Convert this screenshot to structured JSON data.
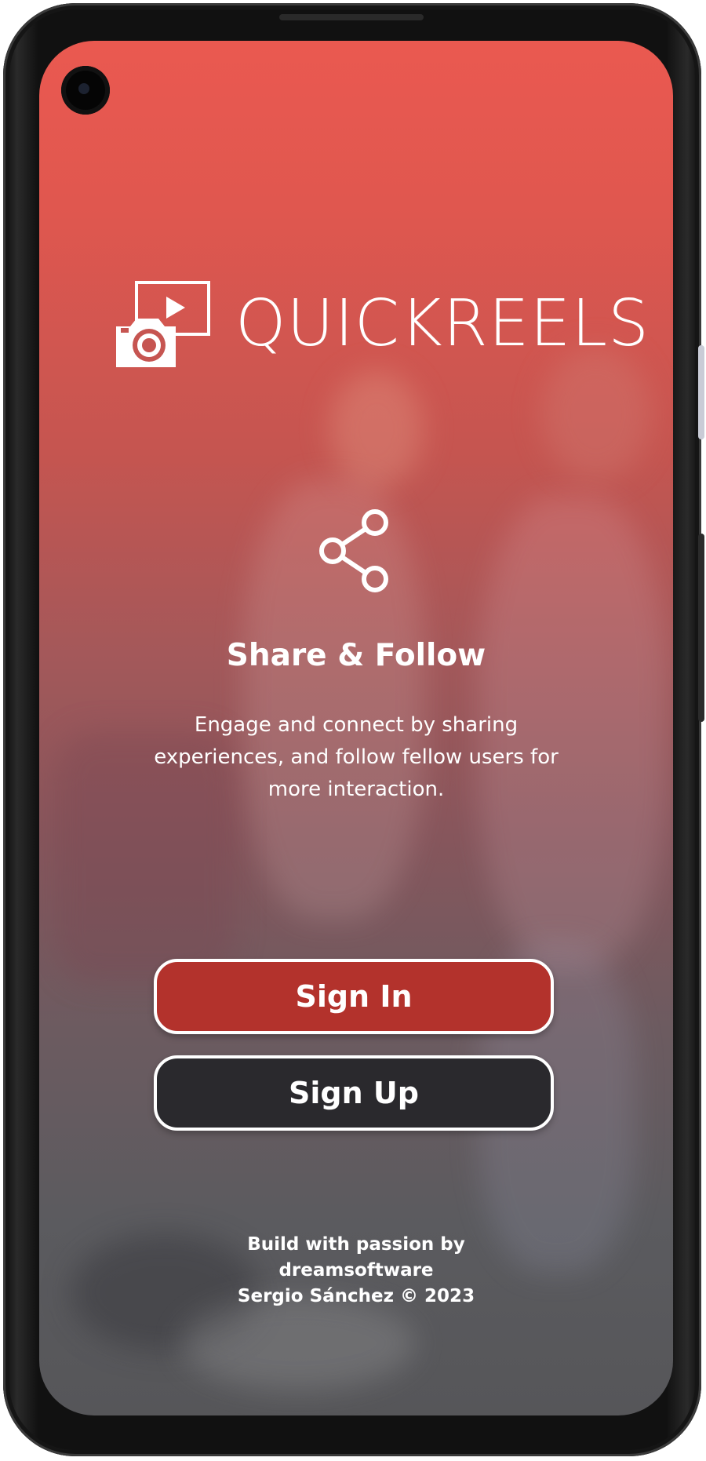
{
  "app": {
    "name": "QUICKREELS"
  },
  "feature": {
    "icon": "share-icon",
    "title": "Share & Follow",
    "description": "Engage and connect by sharing experiences, and follow fellow users for more interaction."
  },
  "buttons": {
    "sign_in": "Sign In",
    "sign_up": "Sign Up"
  },
  "footer": {
    "line1": "Build with passion by",
    "line2": "dreamsoftware",
    "line3": "Sergio Sánchez © 2023"
  },
  "colors": {
    "accent_red": "#b3322c",
    "dark_button": "#2a292d",
    "gradient_top": "#ea5950",
    "gradient_bottom": "#565659"
  }
}
